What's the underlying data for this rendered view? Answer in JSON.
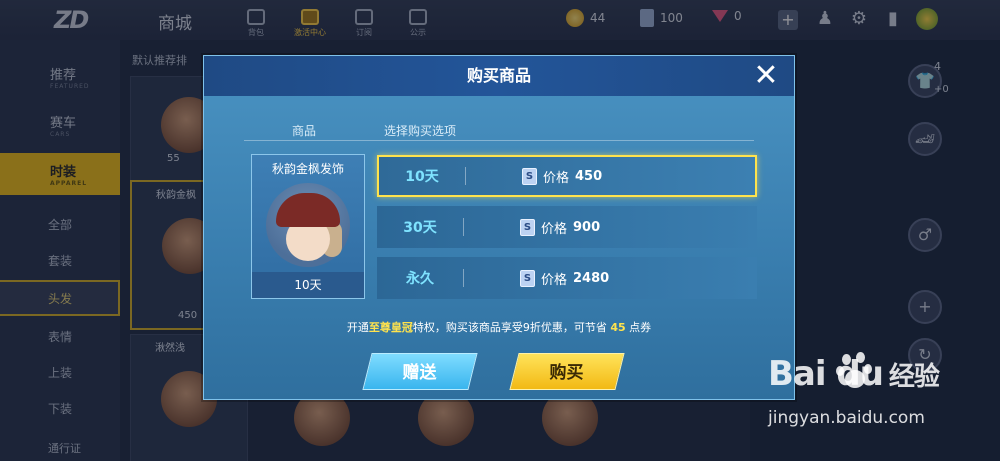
{
  "topbar": {
    "logo_text": "ZD",
    "title": "商城",
    "nav": [
      {
        "label": "背包",
        "active": false
      },
      {
        "label": "激活中心",
        "active": true
      },
      {
        "label": "订阅",
        "active": false
      },
      {
        "label": "公示",
        "active": false
      }
    ],
    "coins": "44",
    "cards": "100",
    "gems": "0"
  },
  "sidebar": {
    "recommend": "推荐",
    "recommend_en": "FEATURED",
    "car": "赛车",
    "car_en": "CARS",
    "fashion": "时装",
    "fashion_en": "APPAREL",
    "sub": [
      "全部",
      "套装",
      "头发",
      "表情",
      "上装",
      "下装"
    ],
    "bottom": "通行证"
  },
  "background": {
    "grid_top_label": "默认推荐排",
    "card_price_1": "55",
    "card_name": "秋韵金枫",
    "card_price_2": "450",
    "card_name_2": "湫然浅",
    "right_count": "4",
    "right_count_sub": "+0"
  },
  "dialog": {
    "title": "购买商品",
    "col_product": "商品",
    "col_options": "选择购买选项",
    "product": {
      "name": "秋韵金枫发饰",
      "duration": "10天"
    },
    "options": [
      {
        "days": "10天",
        "price_label": "价格",
        "price": "450",
        "selected": true
      },
      {
        "days": "30天",
        "price_label": "价格",
        "price": "900",
        "selected": false
      },
      {
        "days": "永久",
        "price_label": "价格",
        "price": "2480",
        "selected": false
      }
    ],
    "promo": {
      "pre": "开通",
      "vip": "至尊皇冠",
      "mid": "特权，购买该商品享受9折优惠，可节省",
      "save": "45",
      "post": "点券"
    },
    "gift_label": "赠送",
    "buy_label": "购买"
  },
  "watermark": {
    "logo": "Bai   du",
    "cn": "经验",
    "url": "jingyan.baidu.com"
  },
  "colors": {
    "dialog_bg": "#3a7fb0",
    "selected_border": "#ffe34d",
    "gift_button": "#39b5ee",
    "buy_button": "#f2b914",
    "days_text": "#7fe3ff"
  },
  "icons": [
    "close-icon",
    "coupon-icon",
    "coin-icon",
    "gem-icon",
    "gear-icon",
    "friends-icon"
  ]
}
